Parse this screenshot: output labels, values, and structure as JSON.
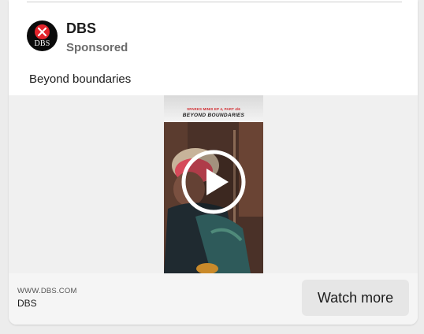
{
  "post": {
    "brand_name": "DBS",
    "sponsored_label": "Sponsored",
    "logo_text": "DBS",
    "caption": "Beyond boundaries"
  },
  "video": {
    "episode_label": "SPARKS MINIS EP 4, PART 4/6",
    "title": "BEYOND BOUNDARIES"
  },
  "footer": {
    "domain": "WWW.DBS.COM",
    "advertiser": "DBS",
    "cta_label": "Watch more"
  },
  "icons": {
    "play": "play-icon",
    "logo": "dbs-logo-icon"
  },
  "colors": {
    "brand_red": "#e3242b",
    "cta_bg": "#e6e6e6"
  }
}
